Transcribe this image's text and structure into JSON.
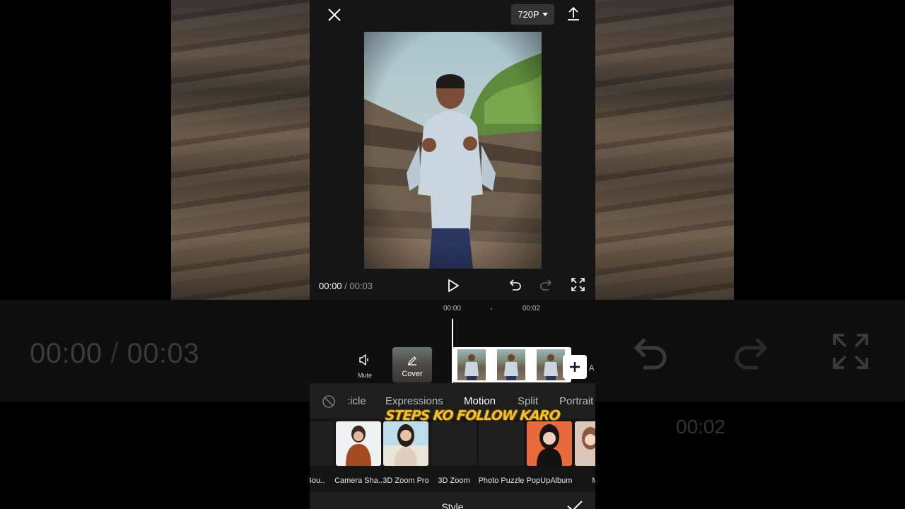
{
  "topbar": {
    "resolution": "720P",
    "close_icon": "close-icon",
    "export_icon": "upload-icon"
  },
  "player": {
    "current_time": "00:00",
    "separator": " / ",
    "duration": "00:03"
  },
  "background_mirror": {
    "current_time": "00:00",
    "separator": " / ",
    "duration": "00:03",
    "ruler_mark": "00:02"
  },
  "timeline": {
    "ruler": [
      "00:00",
      "00:02"
    ],
    "mute_label": "Mute",
    "cover_label": "Cover",
    "add_extra": "A"
  },
  "tabs": {
    "items": [
      {
        "label": ":icle",
        "active": false
      },
      {
        "label": "Expressions",
        "active": false
      },
      {
        "label": "Motion",
        "active": true
      },
      {
        "label": "Split",
        "active": false
      },
      {
        "label": "Portrait",
        "active": false
      }
    ]
  },
  "overlay_text": "STEPS KO FOLLOW KARO",
  "effects": [
    {
      "label": "ra Bou.."
    },
    {
      "label": "Camera Sha.."
    },
    {
      "label": "3D Zoom Pro"
    },
    {
      "label": "3D Zoom"
    },
    {
      "label": "Photo Puzzle"
    },
    {
      "label": "PopUpAlbum"
    },
    {
      "label": "Ma"
    }
  ],
  "footer": {
    "title": "Style"
  },
  "colors": {
    "panel": "#151515",
    "accent_overlay": "#f4c12e"
  }
}
